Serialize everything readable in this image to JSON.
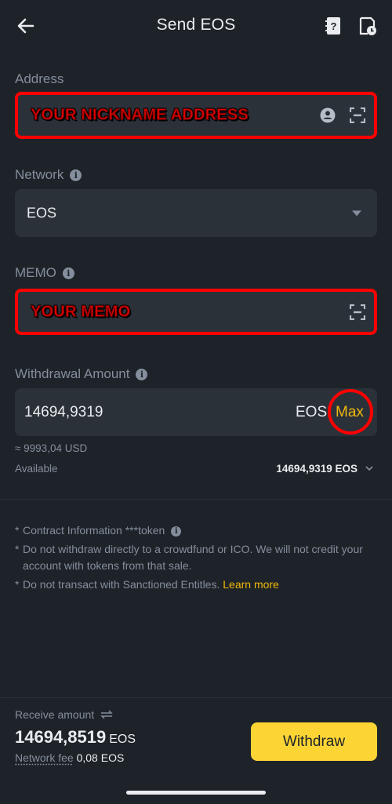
{
  "header": {
    "title": "Send EOS"
  },
  "address": {
    "label": "Address",
    "value": "YOUR NICKNAME ADDRESS"
  },
  "network": {
    "label": "Network",
    "value": "EOS"
  },
  "memo": {
    "label": "MEMO",
    "value": "YOUR MEMO"
  },
  "withdrawal": {
    "label": "Withdrawal Amount",
    "value": "14694,9319",
    "unit": "EOS",
    "max_label": "Max",
    "usd_approx": "≈ 9993,04 USD",
    "available_label": "Available",
    "available_value": "14694,9319 EOS"
  },
  "notes": {
    "contract": "Contract Information ***token",
    "crowdfund": "Do not withdraw directly to a crowdfund or ICO. We will not credit your account with tokens from that sale.",
    "sanction": "Do not transact with Sanctioned Entitles.",
    "learn_more": "Learn more",
    "star": "*"
  },
  "footer": {
    "receive_label": "Receive amount",
    "receive_amount": "14694,8519",
    "receive_unit": "EOS",
    "fee_label": "Network fee",
    "fee_value": "0,08 EOS",
    "withdraw_label": "Withdraw"
  },
  "colors": {
    "background": "#1e2329",
    "field": "#2b3139",
    "accent": "#fcd535",
    "link": "#f0b90b",
    "highlight": "#ff0000"
  },
  "icons": [
    "back-arrow-icon",
    "address-book-icon",
    "history-icon",
    "info-icon",
    "contact-icon",
    "scan-icon",
    "caret-down-icon",
    "swap-icon",
    "chevron-down-icon"
  ]
}
